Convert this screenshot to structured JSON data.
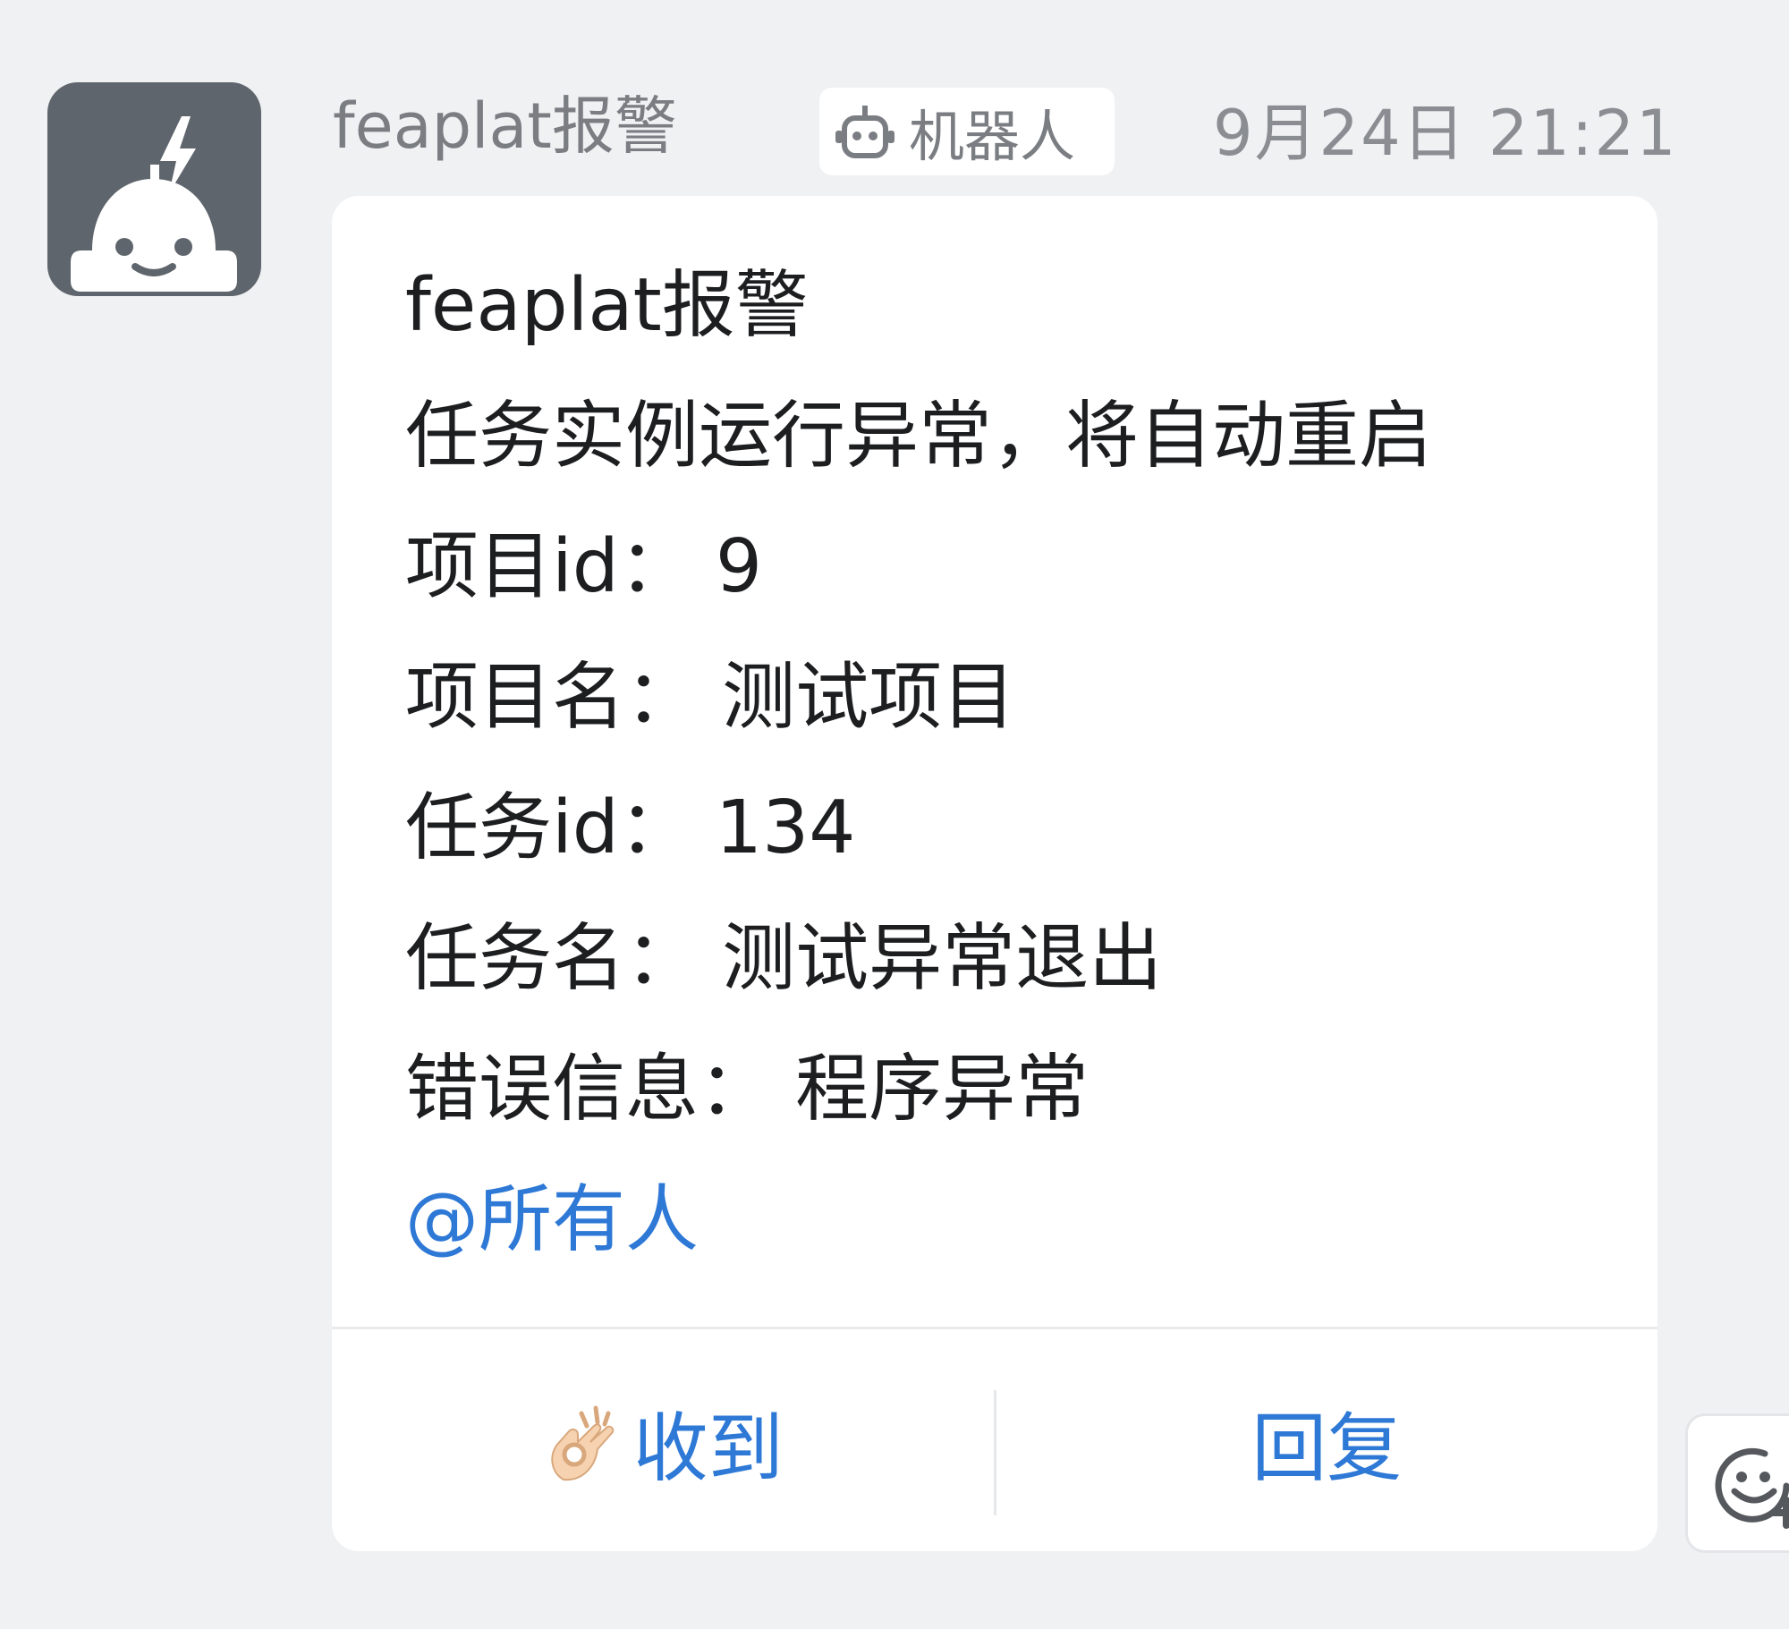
{
  "message": {
    "sender": "feaplat报警",
    "tag": {
      "label": "机器人",
      "icon": "robot-icon"
    },
    "timestamp": "9月24日 21:21",
    "avatar_icon": "robot-avatar-icon",
    "content": {
      "title": "feaplat报警",
      "summary": "任务实例运行异常，将自动重启",
      "project_id": "项目id： 9",
      "project_name": "项目名： 测试项目",
      "task_id": "任务id： 134",
      "task_name": "任务名： 测试异常退出",
      "error_info": "错误信息： 程序异常",
      "mention": "@所有人"
    },
    "actions": {
      "acknowledge": {
        "label": "收到",
        "icon": "ok-hand-emoji-icon"
      },
      "reply": {
        "label": "回复"
      }
    },
    "reaction_icon": "add-reaction-icon"
  },
  "colors": {
    "background": "#f0f1f3",
    "card": "#ffffff",
    "avatar": "#5f656c",
    "link": "#2e78d6",
    "text": "#1d1e20",
    "muted": "#7a7d82"
  }
}
